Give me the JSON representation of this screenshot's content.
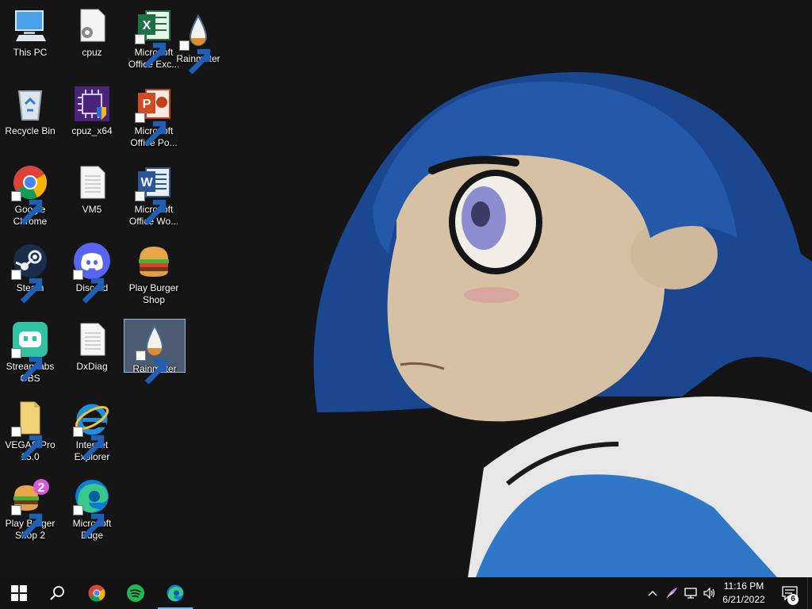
{
  "desktop": {
    "icons": [
      {
        "label": "This PC",
        "icon": "this-pc-icon",
        "shortcut": false
      },
      {
        "label": "cpuz",
        "icon": "settings-file-icon",
        "shortcut": false
      },
      {
        "label": "Microsoft\nOffice Exc...",
        "icon": "excel-icon",
        "shortcut": true
      },
      {
        "label": "Rainmeter",
        "icon": "rainmeter-icon",
        "shortcut": true
      },
      {
        "label": "Recycle Bin",
        "icon": "recycle-bin-icon",
        "shortcut": false
      },
      {
        "label": "cpuz_x64",
        "icon": "cpuz-icon",
        "shortcut": false
      },
      {
        "label": "Microsoft\nOffice Po...",
        "icon": "powerpoint-icon",
        "shortcut": true
      },
      {
        "label": "Google\nChrome",
        "icon": "chrome-icon",
        "shortcut": true
      },
      {
        "label": "VM5",
        "icon": "text-file-icon",
        "shortcut": false
      },
      {
        "label": "Microsoft\nOffice Wo...",
        "icon": "word-icon",
        "shortcut": true
      },
      {
        "label": "Steam",
        "icon": "steam-icon",
        "shortcut": true
      },
      {
        "label": "Discord",
        "icon": "discord-icon",
        "shortcut": true
      },
      {
        "label": "Play Burger\nShop",
        "icon": "burger-icon",
        "shortcut": false
      },
      {
        "label": "Streamlabs\nOBS",
        "icon": "streamlabs-icon",
        "shortcut": true
      },
      {
        "label": "DxDiag",
        "icon": "text-file-icon",
        "shortcut": false
      },
      {
        "label": "Rainmeter",
        "icon": "rainmeter-icon",
        "shortcut": true
      },
      {
        "label": "VEGAS Pro\n15.0",
        "icon": "folder-icon",
        "shortcut": true
      },
      {
        "label": "Internet\nExplorer",
        "icon": "internet-explorer-icon",
        "shortcut": true
      },
      {
        "label": "Play Burger\nShop 2",
        "icon": "burger-shop-2-icon",
        "shortcut": true
      },
      {
        "label": "Microsoft\nEdge",
        "icon": "edge-icon",
        "shortcut": true
      }
    ]
  },
  "taskbar": {
    "start": "windows-start-icon",
    "search": "search-icon",
    "pinned": [
      "chrome-icon",
      "spotify-icon",
      "edge-icon"
    ],
    "tray_icons": [
      "chevron-up-icon",
      "feather-icon",
      "network-icon",
      "volume-icon"
    ],
    "clock": {
      "time": "11:16 PM",
      "date": "6/21/2022"
    },
    "notifications": {
      "count": "6"
    }
  },
  "colors": {
    "taskbar_bg": "#121212",
    "selection": "#7896be",
    "active_indicator": "#76b9ed"
  }
}
